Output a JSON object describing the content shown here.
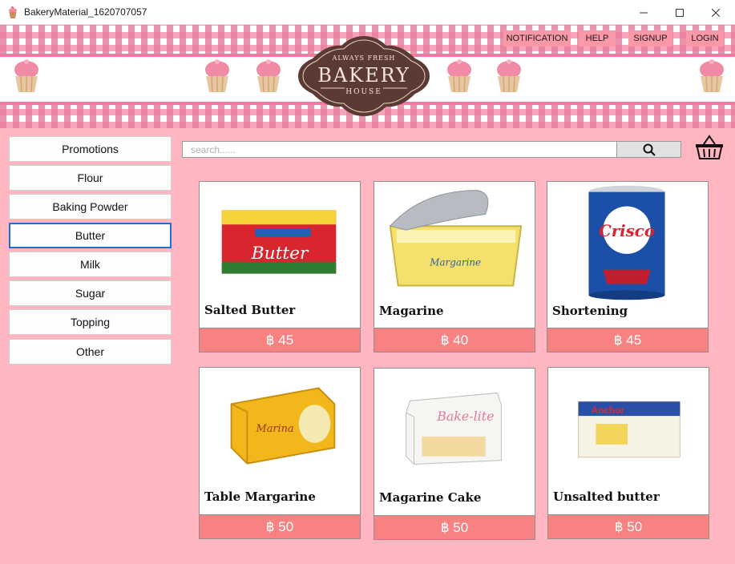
{
  "window": {
    "title": "BakeryMaterial_1620707057"
  },
  "nav": {
    "notification": "NOTIFICATION",
    "help": "HELP",
    "signup": "SIGNUP",
    "login": "LOGIN"
  },
  "logo": {
    "top": "ALWAYS FRESH",
    "main": "BAKERY",
    "bottom": "HOUSE"
  },
  "categories": [
    "Promotions",
    "Flour",
    "Baking Powder",
    "Butter",
    "Milk",
    "Sugar",
    "Topping",
    "Other"
  ],
  "active_category": "Butter",
  "search": {
    "placeholder": "search......"
  },
  "products": [
    {
      "name": "Salted Butter",
      "price": "฿ 45",
      "label": "Butter"
    },
    {
      "name": "Magarine",
      "price": "฿ 40",
      "label": "Margarine"
    },
    {
      "name": "Shortening",
      "price": "฿ 45",
      "label": "Crisco"
    },
    {
      "name": "Table Margarine",
      "price": "฿ 50",
      "label": "Marina"
    },
    {
      "name": "Magarine Cake",
      "price": "฿ 50",
      "label": "Bake-lite"
    },
    {
      "name": "Unsalted butter",
      "price": "฿ 50",
      "label": "Anchor"
    }
  ],
  "colors": {
    "background": "#ffb6c1",
    "price_bar": "#f88181",
    "nav_button": "#fb98a8",
    "logo": "#5b3a33",
    "active_border": "#1f6fd1"
  },
  "icons": {
    "app": "cupcake-icon",
    "search": "search-icon",
    "cart": "basket-icon"
  }
}
